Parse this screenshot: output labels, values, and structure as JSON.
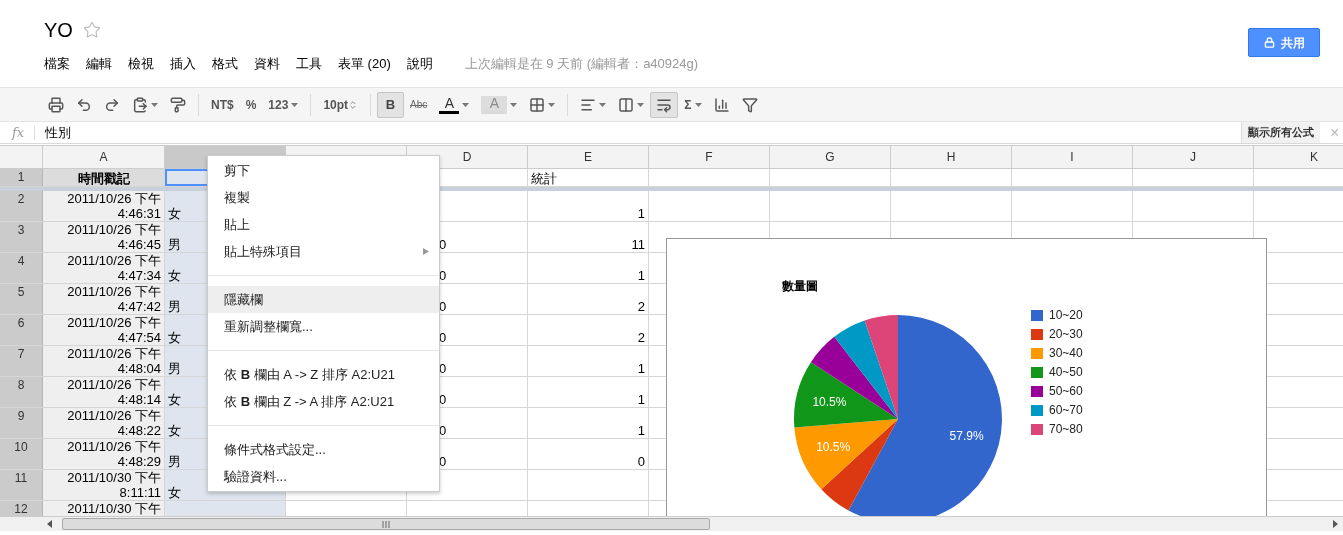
{
  "document": {
    "title": "YO",
    "starred": false
  },
  "menubar": [
    "檔案",
    "編輯",
    "檢視",
    "插入",
    "格式",
    "資料",
    "工具",
    "表單 (20)",
    "說明"
  ],
  "last_edit": "上次編輯是在 9 天前 (編輯者：a40924g)",
  "share_button": "共用",
  "toolbar": [
    {
      "kind": "print",
      "pressed": false,
      "dropdown": false
    },
    {
      "kind": "undo",
      "pressed": false,
      "dropdown": false
    },
    {
      "kind": "redo",
      "pressed": false,
      "dropdown": false
    },
    {
      "kind": "paste",
      "pressed": false,
      "dropdown": true
    },
    {
      "kind": "paint",
      "pressed": false,
      "dropdown": false
    },
    {
      "kind": "separator"
    },
    {
      "kind": "text",
      "label": "NT$",
      "pressed": false,
      "dropdown": false
    },
    {
      "kind": "text",
      "label": "%",
      "pressed": false,
      "dropdown": false
    },
    {
      "kind": "text",
      "label": "123",
      "pressed": false,
      "dropdown": true
    },
    {
      "kind": "separator"
    },
    {
      "kind": "fontsize",
      "label": "10pt",
      "pressed": false,
      "dropdown": false
    },
    {
      "kind": "separator"
    },
    {
      "kind": "bold",
      "label": "B",
      "pressed": true,
      "dropdown": false
    },
    {
      "kind": "strike",
      "label": "Abc",
      "pressed": false,
      "dropdown": false
    },
    {
      "kind": "textcolor",
      "label": "A",
      "pressed": false,
      "dropdown": true
    },
    {
      "kind": "fillcolor",
      "label": "A",
      "pressed": false,
      "dropdown": true
    },
    {
      "kind": "borders",
      "pressed": false,
      "dropdown": true
    },
    {
      "kind": "separator"
    },
    {
      "kind": "align",
      "pressed": false,
      "dropdown": true
    },
    {
      "kind": "merge",
      "pressed": false,
      "dropdown": true
    },
    {
      "kind": "wrap",
      "pressed": true,
      "dropdown": false
    },
    {
      "kind": "text",
      "label": "Σ",
      "pressed": false,
      "dropdown": true
    },
    {
      "kind": "chart",
      "pressed": false,
      "dropdown": false
    },
    {
      "kind": "filter",
      "pressed": false,
      "dropdown": false
    }
  ],
  "formula_bar": {
    "label": "fx",
    "value": "性別",
    "toggle_button": "顯示所有公式",
    "close": "×"
  },
  "columns": [
    {
      "label": "A",
      "selected": false
    },
    {
      "selected": true
    },
    {
      "selected": false
    },
    {
      "label": "D",
      "selected": false
    },
    {
      "label": "E",
      "selected": false
    },
    {
      "label": "F",
      "selected": false
    },
    {
      "label": "G",
      "selected": false
    },
    {
      "label": "H",
      "selected": false
    },
    {
      "label": "I",
      "selected": false
    },
    {
      "label": "J",
      "selected": false
    },
    {
      "label": "K",
      "selected": false
    }
  ],
  "rows": [
    {
      "number": "1",
      "A": "時間戳記",
      "E": "統計"
    },
    {
      "number": "2",
      "A": "2011/10/26 下午 4:46:31",
      "B": "女",
      "E": "1"
    },
    {
      "number": "3",
      "A": "2011/10/26 下午 4:46:45",
      "B": "男",
      "D": "0",
      "E": "11"
    },
    {
      "number": "4",
      "A": "2011/10/26 下午 4:47:34",
      "B": "女",
      "D": "0",
      "E": "1"
    },
    {
      "number": "5",
      "A": "2011/10/26 下午 4:47:42",
      "B": "男",
      "D": "0",
      "E": "2"
    },
    {
      "number": "6",
      "A": "2011/10/26 下午 4:47:54",
      "B": "女",
      "D": "0",
      "E": "2"
    },
    {
      "number": "7",
      "A": "2011/10/26 下午 4:48:04",
      "B": "男",
      "D": "0",
      "E": "1"
    },
    {
      "number": "8",
      "A": "2011/10/26 下午 4:48:14",
      "B": "女",
      "D": "0",
      "E": "1"
    },
    {
      "number": "9",
      "A": "2011/10/26 下午 4:48:22",
      "B": "女",
      "D": "0",
      "E": "1"
    },
    {
      "number": "10",
      "A": "2011/10/26 下午 4:48:29",
      "B": "男",
      "D": "0",
      "E": "0"
    },
    {
      "number": "11",
      "A": "2011/10/30 下午 8:11:11",
      "B": "女"
    },
    {
      "number": "12",
      "A": "2011/10/30 下午"
    }
  ],
  "chart": {
    "chart_data": {
      "type": "pie",
      "title": "數量圖",
      "categories": [
        "10~20",
        "20~30",
        "30~40",
        "40~50",
        "50~60",
        "60~70",
        "70~80"
      ],
      "values": [
        57.9,
        5.3,
        10.5,
        10.5,
        5.3,
        5.3,
        5.2
      ],
      "legend": "right",
      "colors": [
        "#3366cc",
        "#dc3912",
        "#ff9900",
        "#109618",
        "#990099",
        "#0099c6",
        "#dd4477"
      ],
      "value_labels": [
        "57.9%",
        null,
        "10.5%",
        "10.5%",
        null,
        null,
        null
      ]
    }
  },
  "context_menu": [
    [
      {
        "label": "剪下",
        "highlighted": false,
        "submenu": false
      },
      {
        "label": "複製",
        "highlighted": false,
        "submenu": false
      },
      {
        "label": "貼上",
        "highlighted": false,
        "submenu": false
      },
      {
        "label": "貼上特殊項目",
        "highlighted": false,
        "submenu": true
      }
    ],
    [
      {
        "label": "隱藏欄",
        "highlighted": true,
        "submenu": false
      },
      {
        "label": "重新調整欄寬...",
        "highlighted": false,
        "submenu": false
      }
    ],
    [
      {
        "label": "依 **B** 欄由 A -> Z 排序 A2:U21",
        "highlighted": false,
        "submenu": false
      },
      {
        "label": "依 **B** 欄由 Z -> A 排序 A2:U21",
        "highlighted": false,
        "submenu": false
      }
    ],
    [
      {
        "label": "條件式格式設定...",
        "highlighted": false,
        "submenu": false
      },
      {
        "label": "驗證資料...",
        "highlighted": false,
        "submenu": false
      }
    ]
  ]
}
